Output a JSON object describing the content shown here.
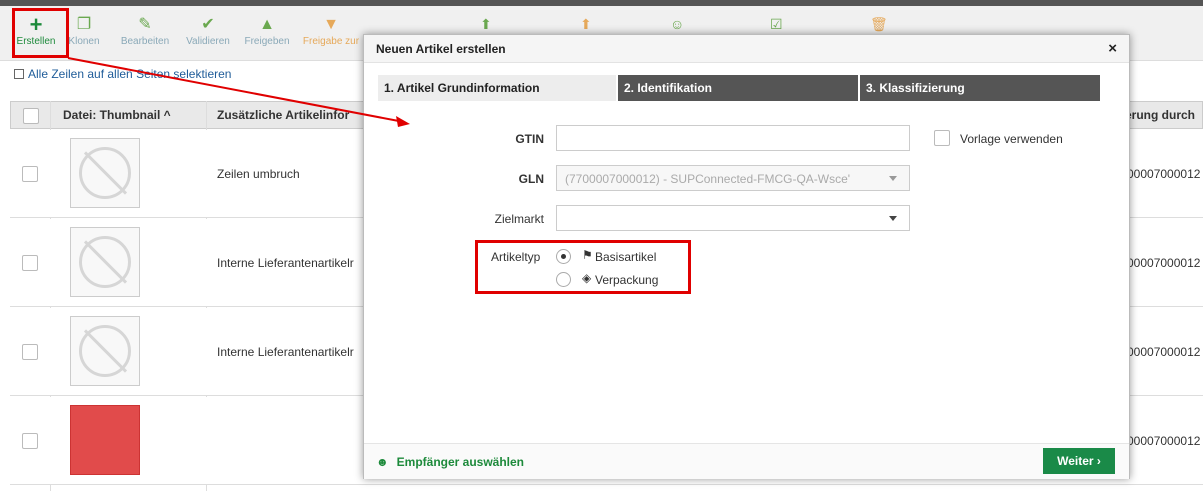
{
  "toolbar": {
    "buttons": [
      {
        "label": "Erstellen",
        "icon": "plus-icon",
        "glyph": "✚"
      },
      {
        "label": "Klonen",
        "icon": "clone-icon",
        "glyph": "❐"
      },
      {
        "label": "Bearbeiten",
        "icon": "pencil-icon",
        "glyph": "✎"
      },
      {
        "label": "Validieren",
        "icon": "check-icon",
        "glyph": "✔"
      },
      {
        "label": "Freigeben",
        "icon": "thumbs-up-icon",
        "glyph": "👍"
      },
      {
        "label": "Freigabe zur",
        "icon": "thumbs-down-icon",
        "glyph": "👎"
      }
    ],
    "extra_icons": [
      "publish-icon",
      "unpublish-icon",
      "users-icon",
      "checkbox-icon",
      "delete-icon"
    ]
  },
  "select_all": {
    "label": "Alle Zeilen auf allen Seiten selektieren"
  },
  "table": {
    "headers": {
      "thumbnail": "Datei: Thumbnail ^",
      "info": "Zusätzliche Artikelinfor",
      "right": "erung durch"
    },
    "rows": [
      {
        "text": "Zeilen umbruch",
        "gln": "00007000012",
        "thumb": "no-image"
      },
      {
        "text": "Interne Lieferantenartikelr",
        "gln": "00007000012",
        "thumb": "no-image"
      },
      {
        "text": "Interne Lieferantenartikelr",
        "gln": "00007000012",
        "thumb": "no-image"
      },
      {
        "text": "",
        "gln": "00007000012",
        "thumb": "red-image"
      }
    ]
  },
  "modal": {
    "title": "Neuen Artikel erstellen",
    "close": "×",
    "steps": [
      "1. Artikel Grundinformation",
      "2. Identifikation",
      "3. Klassifizierung"
    ],
    "gtin_label": "GTIN",
    "gtin_value": "",
    "template_label": "Vorlage verwenden",
    "gln_label": "GLN",
    "gln_value": "(7700007000012) - SUPConnected-FMCG-QA-Wsce'",
    "zielmarkt_label": "Zielmarkt",
    "zielmarkt_value": "",
    "artikeltyp_label": "Artikeltyp",
    "artikeltyp_options": [
      {
        "label": "Basisartikel",
        "icon": "flag-icon",
        "selected": true
      },
      {
        "label": "Verpackung",
        "icon": "box-icon",
        "selected": false
      }
    ],
    "recipients_label": "Empfänger auswählen",
    "next_label": "Weiter",
    "next_icon": "›"
  },
  "colors": {
    "accent_green": "#1a8a48",
    "highlight_red": "#e00000",
    "step_dark": "#555555"
  }
}
